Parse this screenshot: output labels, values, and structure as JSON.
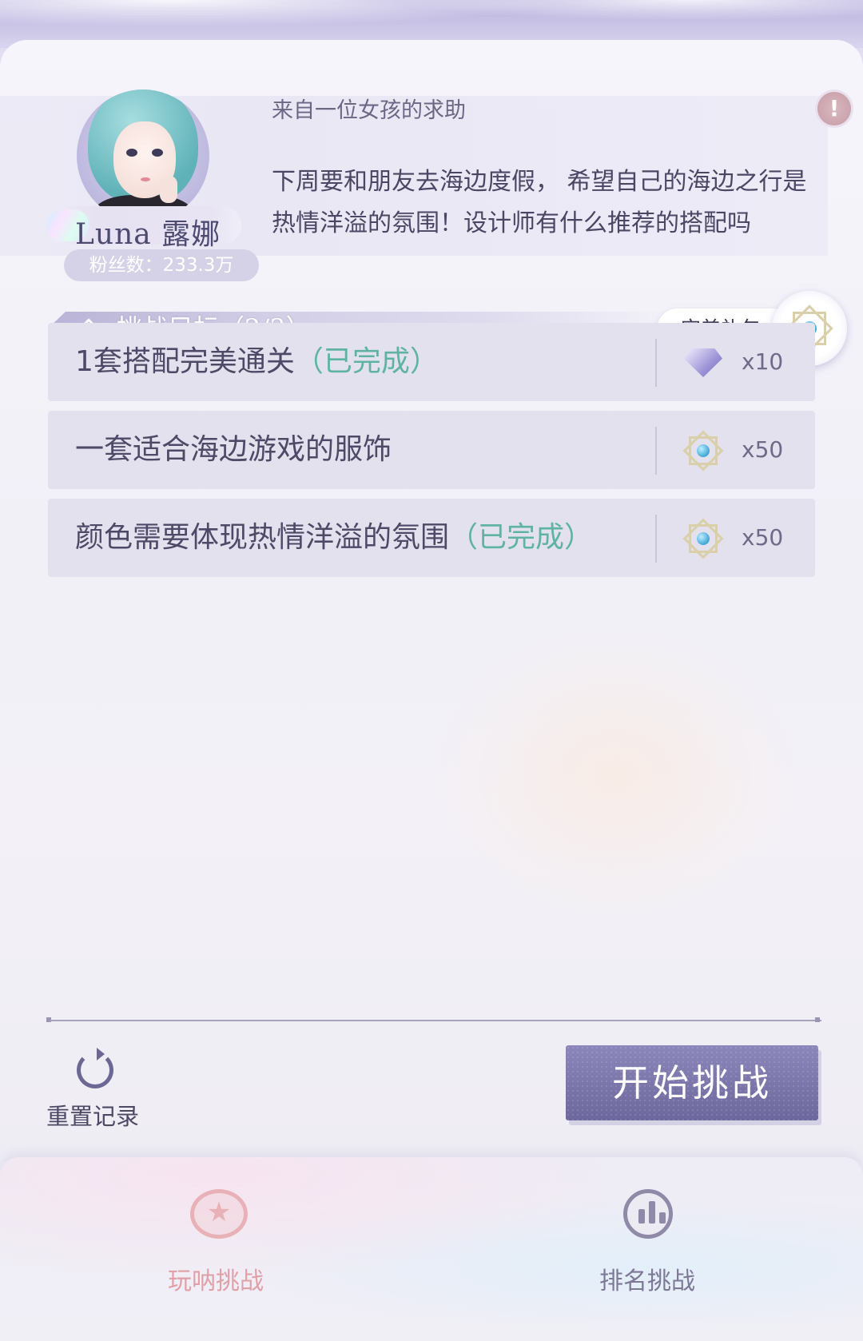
{
  "request": {
    "title": "来自一位女孩的求助",
    "message": "下周要和朋友去海边度假， 希望自己的海边之行是热情洋溢的氛围！设计师有什么推荐的搭配吗",
    "client_name": "Luna 露娜",
    "fans": "粉丝数：233.3万",
    "alert_icon": "exclamation-icon"
  },
  "goals": {
    "label": "挑战目标（2/3）",
    "completed": 2,
    "total": 3,
    "gift_label": "完美礼包"
  },
  "tasks": [
    {
      "text": "1套搭配完美通关",
      "status": "（已完成）",
      "reward_icon": "diamond-icon",
      "reward_count": "x10"
    },
    {
      "text": "一套适合海边游戏的服饰",
      "status": "",
      "reward_icon": "star-frame-icon",
      "reward_count": "x50"
    },
    {
      "text": "颜色需要体现热情洋溢的氛围",
      "status": "（已完成）",
      "reward_icon": "star-frame-icon",
      "reward_count": "x50"
    }
  ],
  "actions": {
    "reset_label": "重置记录",
    "start_label": "开始挑战"
  },
  "nav": [
    {
      "label": "玩呐挑战",
      "active": true,
      "color": "#e0a0a8"
    },
    {
      "label": "排名挑战",
      "active": false,
      "color": "#7c7896"
    }
  ],
  "colors": {
    "accent": "#7e79ad",
    "completed": "#5fb3a1"
  }
}
